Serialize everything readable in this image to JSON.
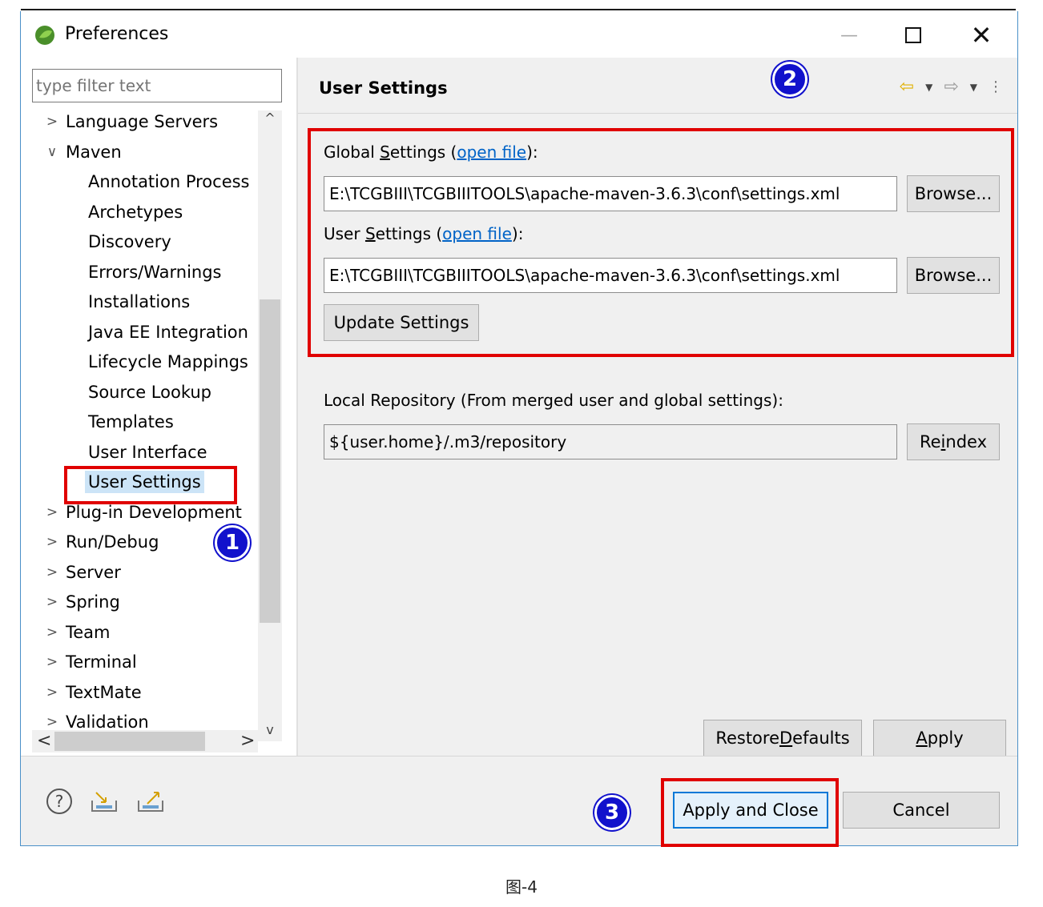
{
  "window": {
    "title": "Preferences",
    "min": "—",
    "close": "✕"
  },
  "filter": {
    "placeholder": "type filter text"
  },
  "tree": {
    "items": [
      {
        "label": "Language Servers",
        "expanded": false
      },
      {
        "label": "Maven",
        "expanded": true
      },
      {
        "label": "Annotation Process"
      },
      {
        "label": "Archetypes"
      },
      {
        "label": "Discovery"
      },
      {
        "label": "Errors/Warnings"
      },
      {
        "label": "Installations"
      },
      {
        "label": "Java EE Integration"
      },
      {
        "label": "Lifecycle Mappings"
      },
      {
        "label": "Source Lookup"
      },
      {
        "label": "Templates"
      },
      {
        "label": "User Interface"
      },
      {
        "label": "User Settings",
        "selected": true
      },
      {
        "label": "Plug-in Development",
        "expanded": false
      },
      {
        "label": "Run/Debug",
        "expanded": false
      },
      {
        "label": "Server",
        "expanded": false
      },
      {
        "label": "Spring",
        "expanded": false
      },
      {
        "label": "Team",
        "expanded": false
      },
      {
        "label": "Terminal",
        "expanded": false
      },
      {
        "label": "TextMate",
        "expanded": false
      },
      {
        "label": "Validation",
        "expanded": false
      }
    ],
    "twisty_collapsed": ">",
    "twisty_expanded": "∨"
  },
  "page": {
    "title": "User Settings",
    "global_label_pre": "Global ",
    "global_label_ul": "S",
    "global_label_post": "ettings (",
    "open_file": "open file",
    "label_close": "):",
    "global_value": "E:\\TCGBIII\\TCGBIIITOOLS\\apache-maven-3.6.3\\conf\\settings.xml",
    "user_label_pre": "User ",
    "user_label_ul": "S",
    "user_label_post": "ettings (",
    "user_value": "E:\\TCGBIII\\TCGBIIITOOLS\\apache-maven-3.6.3\\conf\\settings.xml",
    "browse": "Browse...",
    "update": "Update Settings",
    "local_label": "Local Repository (From merged user and global settings):",
    "local_value": "${user.home}/.m3/repository",
    "reindex_pre": "Re",
    "reindex_ul": "i",
    "reindex_post": "ndex",
    "restore_pre": "Restore ",
    "restore_ul": "D",
    "restore_post": "efaults",
    "apply_ul": "A",
    "apply_post": "pply"
  },
  "footer": {
    "apply_close": "Apply and Close",
    "cancel": "Cancel",
    "help": "?"
  },
  "badges": {
    "one": "1",
    "two": "2",
    "three": "3"
  },
  "colors": {
    "annotation_red": "#e00000",
    "badge_blue": "#1111cc",
    "link": "#0063c7",
    "selection": "#cce4f7"
  },
  "caption": "图-4"
}
